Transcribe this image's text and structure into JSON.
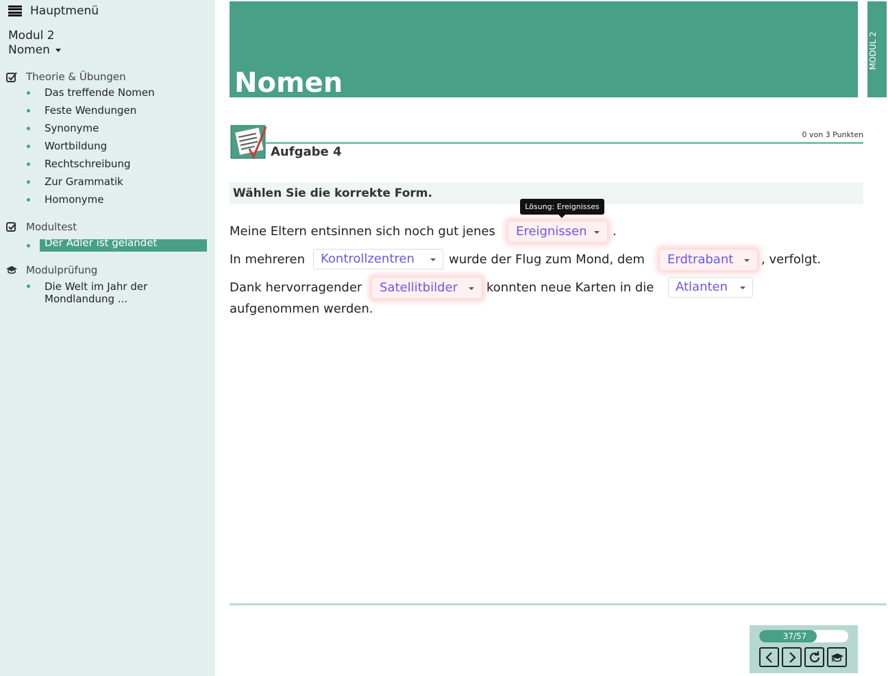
{
  "sidebar": {
    "menu_label": "Hauptmenü",
    "module": "Modul 2",
    "topic": "Nomen",
    "sections": [
      {
        "title": "Theorie & Übungen",
        "icon": "edit-check-icon",
        "items": [
          "Das treffende Nomen",
          "Feste Wendungen",
          "Synonyme",
          "Wortbildung",
          "Rechtschreibung",
          "Zur Grammatik",
          "Homonyme"
        ]
      },
      {
        "title": "Modultest",
        "icon": "checkbox-check-icon",
        "items": [
          "Der Adler ist gelandet"
        ]
      },
      {
        "title": "Modulprüfung",
        "icon": "graduation-cap-icon",
        "items": [
          "Die Welt im Jahr der Mondlandung ..."
        ]
      }
    ],
    "active_item": "Der Adler ist gelandet"
  },
  "header": {
    "title": "Nomen",
    "side_tab": "MODUL 2"
  },
  "task": {
    "title": "Aufgabe 4",
    "points": "0 von 3 Punkten",
    "instruction": "Wählen Sie die korrekte Form."
  },
  "tooltip": "Lösung: Ereignisses",
  "sentences": {
    "s1_a": "Meine Eltern entsinnen sich noch gut jenes",
    "s1_drop": "Ereignissen",
    "s1_b": ".",
    "s2_a": "In mehreren",
    "s2_drop1": "Kontrollzentren",
    "s2_b": "wurde der Flug zum Mond, dem",
    "s2_drop2": "Erdtrabant",
    "s2_c": ", verfolgt.",
    "s3_a": "Dank hervorragender",
    "s3_drop1": "Satellitbilder",
    "s3_b": "konnten neue Karten in die",
    "s3_drop2": "Atlanten",
    "s3_c": "aufgenommen werden."
  },
  "nav": {
    "progress_text": "37/57",
    "progress_fraction": 0.649,
    "buttons": [
      "chevron-left-icon",
      "chevron-right-icon",
      "refresh-icon",
      "graduation-cap-icon"
    ]
  },
  "colors": {
    "accent": "#48a086",
    "sidebar_bg": "#e3efec",
    "dropdown_text": "#6a58e6",
    "wrong_glow": "#ffd5d8"
  }
}
